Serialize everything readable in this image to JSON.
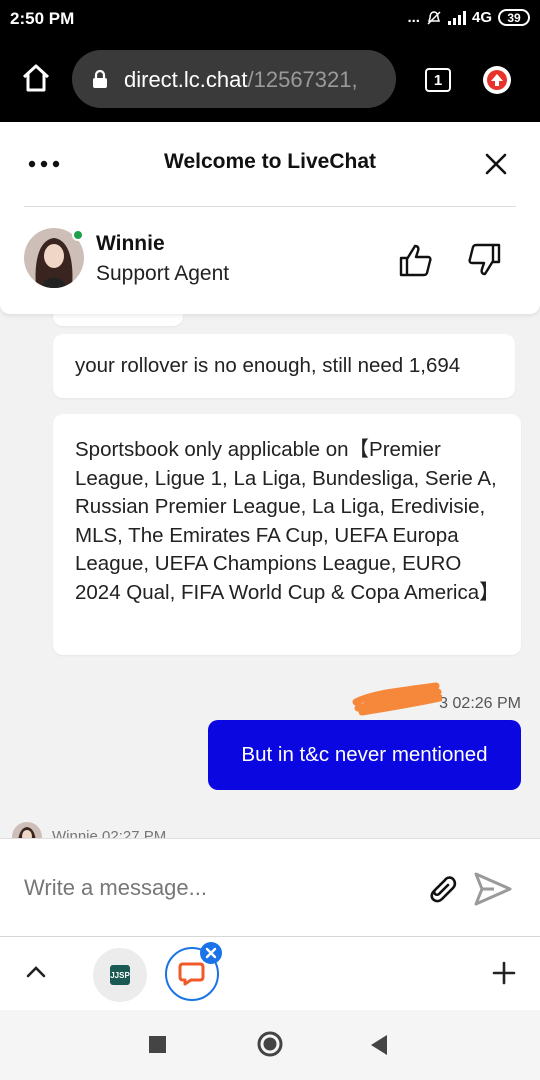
{
  "status_bar": {
    "time": "2:50 PM",
    "signal_dots": "...",
    "network": "4G",
    "battery": "39"
  },
  "browser": {
    "url_host": "direct.lc.chat",
    "url_path": "/12567321,",
    "tab_count": "1"
  },
  "chat_header": {
    "title": "Welcome to LiveChat",
    "agent_name": "Winnie",
    "agent_role": "Support Agent"
  },
  "messages": [
    {
      "from": "agent",
      "text": "your rollover is no enough, still need 1,694"
    },
    {
      "from": "agent",
      "text": "Sportsbook only applicable on【Premier League, Ligue 1, La Liga, Bundesliga, Serie A, Russian Premier League, La Liga, Eredivisie, MLS, The Emirates FA Cup, UEFA Europa League, UEFA Champions League, EURO 2024 Qual, FIFA World Cup & Copa America】"
    },
    {
      "from": "user",
      "meta": "3 02:26 PM",
      "text": "But in t&c never mentioned"
    },
    {
      "from": "agent",
      "meta": "Winnie 02:27 PM"
    }
  ],
  "composer": {
    "placeholder": "Write a message..."
  },
  "bottom_toolbar": {
    "app_badge": "JJSP"
  },
  "colors": {
    "outgoing_bubble": "#0a07e0",
    "online": "#1f9f4a",
    "redaction": "#f5883a",
    "accent": "#1a73e8",
    "upload": "#e8332a"
  }
}
